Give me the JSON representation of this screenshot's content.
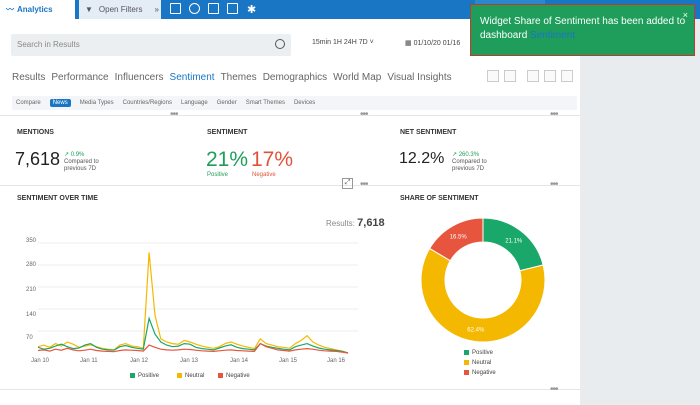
{
  "topbar": {
    "analytics_label": "Analytics",
    "filters_label": "Open Filters"
  },
  "search": {
    "placeholder": "Search in Results"
  },
  "time_ranges": "15min 1H 24H 7D ˅",
  "date_range": "01/10/20 01/16",
  "tabs": [
    "Results",
    "Performance",
    "Influencers",
    "Sentiment",
    "Themes",
    "Demographics",
    "World Map",
    "Visual Insights"
  ],
  "active_tab": "Sentiment",
  "subnav": [
    "Compare",
    "News",
    "Media Types",
    "Countries/Regions",
    "Language",
    "Gender",
    "Smart Themes",
    "Devices"
  ],
  "mentions": {
    "title": "MENTIONS",
    "value": "7,618",
    "change": "↗ 0.9%",
    "compared": "Compared to",
    "period": "previous 7D"
  },
  "sentiment": {
    "title": "SENTIMENT",
    "positive_value": "21%",
    "positive_label": "Positive",
    "negative_value": "17%",
    "negative_label": "Negative"
  },
  "net_sentiment": {
    "title": "NET SENTIMENT",
    "value": "12.2%",
    "change": "↗ 260.3%",
    "compared": "Compared to",
    "period": "previous 7D"
  },
  "sot": {
    "title": "SENTIMENT OVER TIME",
    "results_label": "Results:",
    "results_value": "7,618",
    "legend": [
      "Positive",
      "Neutral",
      "Negative"
    ]
  },
  "sos": {
    "title": "SHARE OF SENTIMENT",
    "legend": [
      "Positive",
      "Neutral",
      "Negative"
    ]
  },
  "toast": {
    "text": "Widget Share of Sentiment has been added to dashboard",
    "link": "Sentiment",
    "close": "×"
  },
  "colors": {
    "positive": "#1aa86a",
    "neutral": "#f5b800",
    "negative": "#e8553e",
    "brand": "#1976c4"
  },
  "chart_data": [
    {
      "type": "line",
      "title": "SENTIMENT OVER TIME",
      "x": [
        "Jan 10",
        "Jan 11",
        "Jan 12",
        "Jan 13",
        "Jan 14",
        "Jan 15",
        "Jan 16"
      ],
      "ylim": [
        0,
        350
      ],
      "yticks": [
        70,
        140,
        210,
        280,
        350
      ],
      "series": [
        {
          "name": "Positive",
          "values": [
            18,
            12,
            15,
            22,
            28,
            20,
            14,
            16,
            25,
            30,
            18,
            12,
            10,
            9,
            20,
            24,
            18,
            15,
            12,
            110,
            60,
            35,
            25,
            20,
            22,
            30,
            28,
            18,
            14,
            12,
            10,
            16,
            22,
            26,
            18,
            14,
            12,
            10,
            30,
            22,
            18,
            15,
            12,
            10,
            20,
            25,
            30,
            22,
            16,
            12,
            10,
            8,
            5,
            0
          ]
        },
        {
          "name": "Neutral",
          "values": [
            20,
            25,
            18,
            30,
            22,
            35,
            28,
            18,
            22,
            26,
            20,
            15,
            12,
            10,
            25,
            30,
            22,
            20,
            15,
            320,
            120,
            45,
            35,
            30,
            28,
            40,
            35,
            28,
            22,
            18,
            15,
            20,
            30,
            35,
            28,
            22,
            18,
            14,
            45,
            30,
            25,
            20,
            18,
            15,
            30,
            40,
            55,
            35,
            25,
            18,
            14,
            10,
            6,
            0
          ]
        },
        {
          "name": "Negative",
          "values": [
            8,
            10,
            6,
            12,
            9,
            15,
            10,
            7,
            9,
            12,
            8,
            6,
            5,
            4,
            8,
            10,
            9,
            8,
            6,
            25,
            18,
            12,
            10,
            9,
            10,
            12,
            11,
            9,
            7,
            6,
            5,
            7,
            9,
            10,
            8,
            7,
            6,
            5,
            30,
            20,
            15,
            10,
            8,
            6,
            10,
            12,
            14,
            12,
            9,
            7,
            6,
            5,
            3,
            0
          ]
        }
      ]
    },
    {
      "type": "pie",
      "title": "SHARE OF SENTIMENT",
      "categories": [
        "Positive",
        "Neutral",
        "Negative"
      ],
      "values": [
        21.1,
        62.4,
        16.5
      ],
      "labels": [
        "21.1%",
        "62.4%",
        "16.5%"
      ]
    }
  ]
}
